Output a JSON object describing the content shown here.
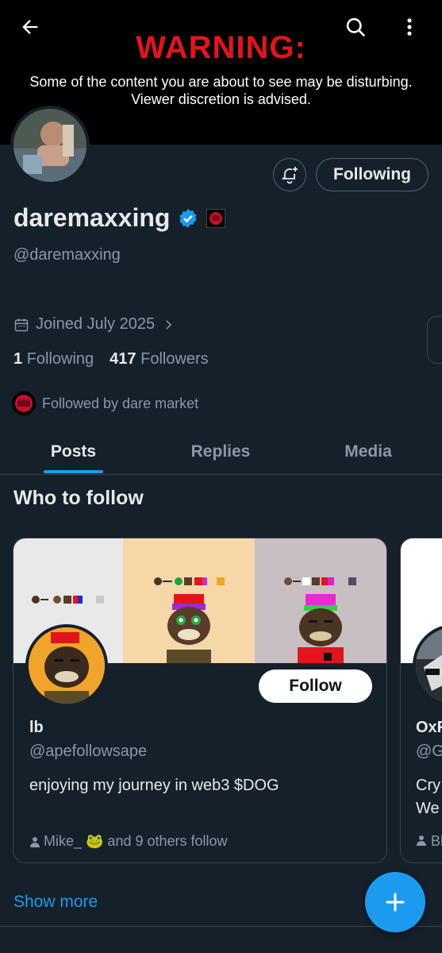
{
  "banner": {
    "warning_title": "WARNING:",
    "warning_line1": "Some of the content you are about to see may be disturbing.",
    "warning_line2": "Viewer discretion is advised."
  },
  "profile": {
    "display_name": "daremaxxing",
    "handle": "@daremaxxing",
    "joined": "Joined July 2025",
    "following_count": "1",
    "following_label": "Following",
    "followers_count": "417",
    "followers_label": "Followers",
    "followed_by": "Followed by dare market",
    "following_button": "Following"
  },
  "tabs": [
    {
      "label": "Posts",
      "active": true
    },
    {
      "label": "Replies",
      "active": false
    },
    {
      "label": "Media",
      "active": false
    }
  ],
  "who_to_follow": {
    "title": "Who to follow",
    "cards": [
      {
        "name": "lb",
        "handle": "@apefollowsape",
        "bio": "enjoying my journey in web3 $DOG",
        "social_proof": "Mike_ 🐸 and 9 others follow",
        "follow_label": "Follow"
      },
      {
        "name": "OxF",
        "handle": "@G",
        "bio_line1": "Cry",
        "bio_line2": "We",
        "social_proof": "Bl"
      }
    ],
    "show_more": "Show more"
  },
  "colors": {
    "background": "#15202b",
    "accent": "#1d9bf0",
    "warning": "#e2151c"
  },
  "icons": [
    "back-arrow-icon",
    "search-icon",
    "more-vertical-icon",
    "bell-plus-icon",
    "verified-badge-icon",
    "calendar-icon",
    "chevron-right-icon",
    "person-icon",
    "plus-icon"
  ]
}
